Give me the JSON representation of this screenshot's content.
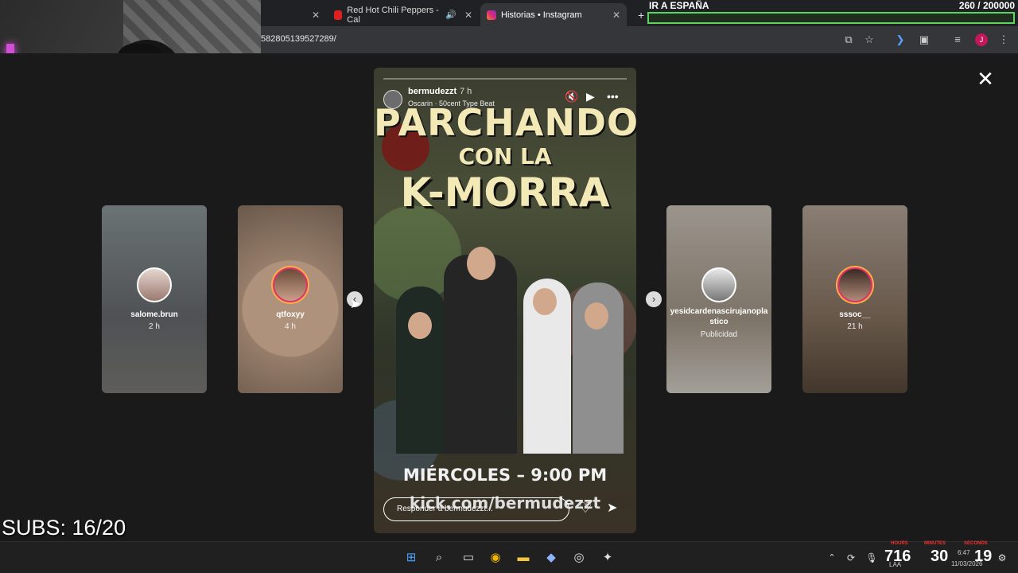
{
  "browser": {
    "tabs": [
      {
        "title": "Red Hot Chili Peppers - Cal",
        "icon": "youtube-icon",
        "muted_icon": "speaker-icon"
      },
      {
        "title": "Historias • Instagram",
        "icon": "instagram-icon"
      }
    ],
    "url": "582805139527289/",
    "new_tab": "+"
  },
  "overlay": {
    "goal_label": "IR A ESPAÑA",
    "goal_count": "260 / 200000",
    "subs": "SUBS: 16/20"
  },
  "stories": {
    "left": [
      {
        "user": "salome.brun",
        "age": "2 h"
      },
      {
        "user": "qtfoxyy",
        "age": "4 h"
      }
    ],
    "right": [
      {
        "user": "yesidcardenascirujanopla stico",
        "age": "Publicidad"
      },
      {
        "user": "sssoc__",
        "age": "21 h"
      }
    ],
    "main": {
      "user": "bermudezzt",
      "time": "7 h",
      "song": "Oscarin · 50cent Type Beat",
      "title_line1": "PARCHANDO",
      "title_line2": "CON LA",
      "title_line3": "K-MORRA",
      "date_text": "MIÉRCOLES – 9:00 PM",
      "link_text": "kick.com/bermudezzt",
      "reply_placeholder": "Responder a bermudezzt..."
    }
  },
  "taskbar": {
    "counter_a": "716",
    "counter_b": "30",
    "counter_c": "19",
    "labels": [
      "HOURS",
      "MINUTES",
      "SECONDS"
    ],
    "time": "6:47",
    "date": "11/03/2026",
    "lang": "LAA"
  },
  "colors": {
    "goal_bar": "#5fd35f",
    "story_ring": "#e1306c"
  }
}
